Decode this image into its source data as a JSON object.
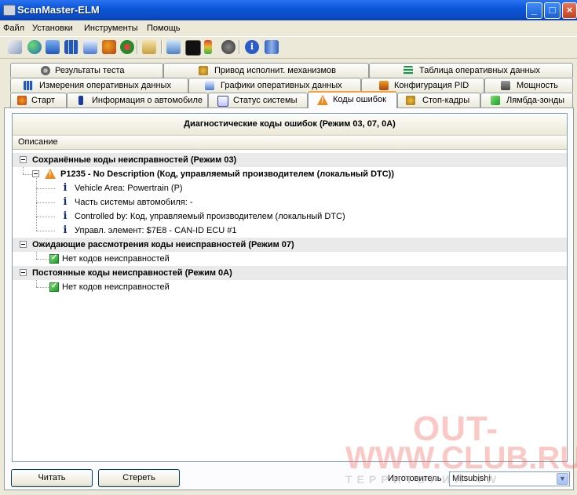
{
  "window": {
    "title": "ScanMaster-ELM"
  },
  "menu": {
    "items": [
      "Файл",
      "Установки",
      "Инструменты",
      "Помощь"
    ]
  },
  "toolbar": {
    "icons": [
      "connect-icon",
      "globe-icon",
      "report-icon",
      "grid-icon",
      "chart-icon",
      "people-icon",
      "clipboard-icon",
      "monitor-icon",
      "terminal-icon",
      "traffic-light-icon",
      "gauge-icon",
      "info-icon",
      "book-icon"
    ]
  },
  "tabs": {
    "row1": [
      "Результаты теста",
      "Привод исполнит. механизмов",
      "Таблица оперативных данных"
    ],
    "row2": [
      "Измерения оперативных данных",
      "Графики оперативных данных",
      "Конфигурация PID",
      "Мощность"
    ],
    "row3": [
      "Старт",
      "Информация о автомобиле",
      "Статус системы",
      "Коды ошибок",
      "Стоп-кадры",
      "Лямбда-зонды"
    ],
    "active": "Коды ошибок"
  },
  "dtc": {
    "header_title": "Диагностические коды ошибок (Режим 03, 07, 0A)",
    "column_label": "Описание",
    "stored_group": "Сохранённые коды неисправностей (Режим 03)",
    "stored_code": "P1235 - No Description (Код, управляемый производителем (локальный DTC))",
    "stored_details": [
      "Vehicle Area: Powertrain (P)",
      "Часть системы автомобиля: -",
      "Controlled by: Код, управляемый производителем (локальный DTC)",
      "Управл. элемент: $7E8 - CAN-ID ECU #1"
    ],
    "pending_group": "Ожидающие рассмотрения коды неисправностей (Режим 07)",
    "pending_none": "Нет кодов неисправностей",
    "permanent_group": "Постоянные коды неисправностей  (Режим 0A)",
    "permanent_none": "Нет кодов неисправностей"
  },
  "bottom": {
    "read_button": "Читать",
    "clear_button": "Стереть",
    "manufacturer_label": "Изготовитель",
    "manufacturer_value": "Mitsubishi"
  },
  "watermark": {
    "line1": "OUT-",
    "line2": "WWW.CLUB.RU",
    "line3": "ТЕРРИТОРИЯ 4W"
  }
}
